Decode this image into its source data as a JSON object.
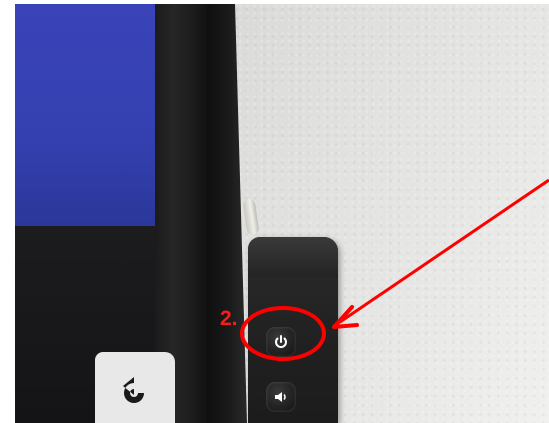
{
  "annotation": {
    "step_label": "2.",
    "highlight_color": "#ff0000"
  },
  "controls": {
    "power_button_icon": "power-icon",
    "volume_button_icon": "volume-icon"
  },
  "screen": {
    "back_icon": "back-arrow-icon",
    "top_color": "#3440b0",
    "bottom_color": "#141416"
  }
}
